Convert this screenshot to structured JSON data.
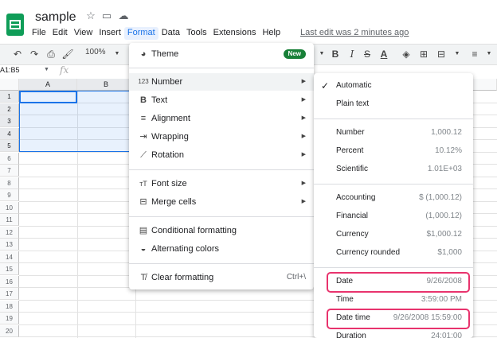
{
  "doc": {
    "title": "sample",
    "last_edit": "Last edit was 2 minutes ago"
  },
  "menu": {
    "items": [
      "File",
      "Edit",
      "View",
      "Insert",
      "Format",
      "Data",
      "Tools",
      "Extensions",
      "Help"
    ],
    "active": "Format"
  },
  "toolbar": {
    "zoom": "100%",
    "undo_icon": "undo-icon",
    "redo_icon": "redo-icon",
    "print_icon": "print-icon",
    "paint_format_icon": "paint-format-icon",
    "bold": "B",
    "italic": "I",
    "strike": "S",
    "text_color": "A"
  },
  "formula_bar": {
    "name_box": "A1:B5",
    "fx": "fx"
  },
  "grid": {
    "columns": [
      "A",
      "B"
    ],
    "rows": [
      "1",
      "2",
      "3",
      "4",
      "5",
      "6",
      "7",
      "8",
      "9",
      "10",
      "11",
      "12",
      "13",
      "14",
      "15",
      "16",
      "17",
      "18",
      "19",
      "20"
    ]
  },
  "format_menu": {
    "theme": {
      "label": "Theme",
      "badge": "New",
      "icon": "palette-icon"
    },
    "number": {
      "label": "Number",
      "icon": "123-icon"
    },
    "text": {
      "label": "Text",
      "icon": "bold-icon"
    },
    "alignment": {
      "label": "Alignment",
      "icon": "align-left-icon"
    },
    "wrapping": {
      "label": "Wrapping",
      "icon": "wrap-icon"
    },
    "rotation": {
      "label": "Rotation",
      "icon": "rotation-icon"
    },
    "font_size": {
      "label": "Font size",
      "icon": "font-size-icon"
    },
    "merge_cells": {
      "label": "Merge cells",
      "icon": "merge-icon"
    },
    "conditional": {
      "label": "Conditional formatting",
      "icon": "conditional-format-icon"
    },
    "alternating": {
      "label": "Alternating colors",
      "icon": "fill-drop-icon"
    },
    "clear": {
      "label": "Clear formatting",
      "shortcut": "Ctrl+\\",
      "icon": "clear-format-icon"
    }
  },
  "number_submenu": {
    "automatic": {
      "label": "Automatic",
      "checked": true
    },
    "plain_text": {
      "label": "Plain text"
    },
    "number": {
      "label": "Number",
      "example": "1,000.12"
    },
    "percent": {
      "label": "Percent",
      "example": "10.12%"
    },
    "scientific": {
      "label": "Scientific",
      "example": "1.01E+03"
    },
    "accounting": {
      "label": "Accounting",
      "example": "$ (1,000.12)"
    },
    "financial": {
      "label": "Financial",
      "example": "(1,000.12)"
    },
    "currency": {
      "label": "Currency",
      "example": "$1,000.12"
    },
    "currency_rounded": {
      "label": "Currency rounded",
      "example": "$1,000"
    },
    "date": {
      "label": "Date",
      "example": "9/26/2008"
    },
    "time": {
      "label": "Time",
      "example": "3:59:00 PM"
    },
    "date_time": {
      "label": "Date time",
      "example": "9/26/2008 15:59:00"
    },
    "duration": {
      "label": "Duration",
      "example": "24:01:00"
    }
  },
  "colors": {
    "accent": "#1a73e8",
    "highlight": "#e8336d",
    "new_badge": "#188038",
    "sheets_green": "#0f9d58"
  }
}
